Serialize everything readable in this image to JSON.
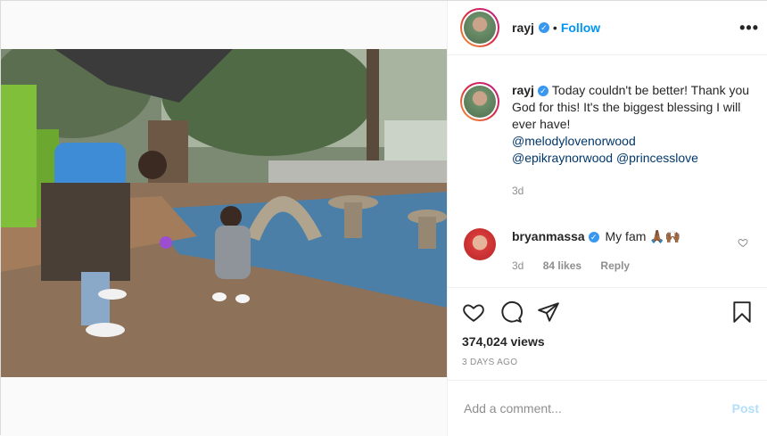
{
  "header": {
    "username": "rayj",
    "separator": "•",
    "follow_label": "Follow",
    "more_label": "•••"
  },
  "caption": {
    "username": "rayj",
    "text": "Today couldn't be better! Thank you God for this! It's the biggest blessing I will ever have!",
    "mentions": [
      "@melodylovenorwood",
      "@epikraynorwood",
      "@princesslove"
    ],
    "age": "3d"
  },
  "comment": {
    "username": "bryanmassa",
    "text": "My fam 🙏🏾🙌🏾",
    "age": "3d",
    "likes": "84 likes",
    "reply_label": "Reply"
  },
  "stats": {
    "views": "374,024 views",
    "date": "3 DAYS AGO"
  },
  "add_comment": {
    "placeholder": "Add a comment...",
    "post_label": "Post"
  },
  "colors": {
    "accent": "#0095f6",
    "verified": "#3897f0",
    "post_disabled": "#b2dffc"
  },
  "icons": [
    "verified-icon",
    "more-icon",
    "heart-icon",
    "comment-icon",
    "share-icon",
    "bookmark-icon"
  ]
}
